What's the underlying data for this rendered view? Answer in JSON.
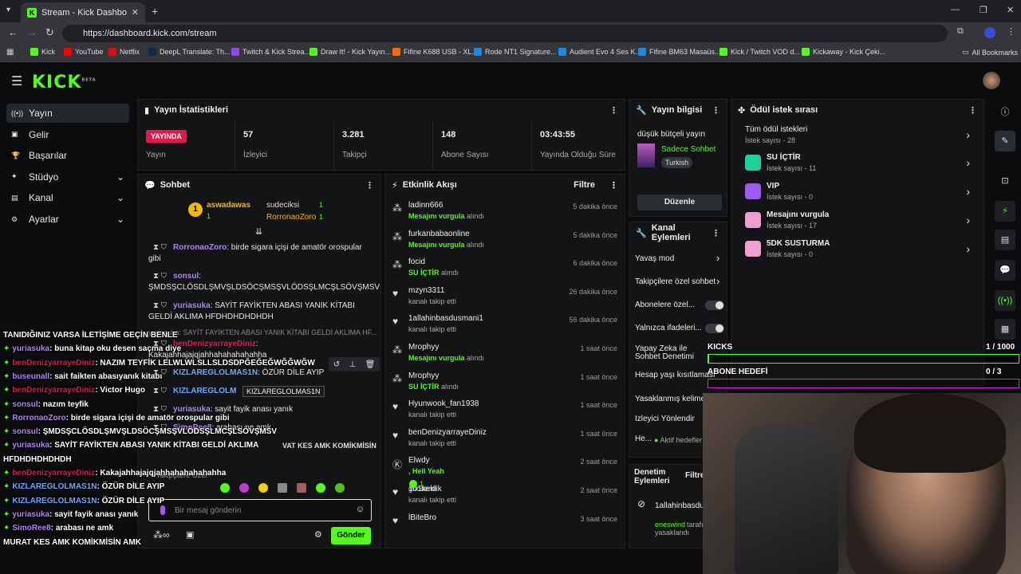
{
  "browser": {
    "tab_title": "Stream - Kick Dashboard",
    "url": "https://dashboard.kick.com/stream",
    "bookmarks": [
      "Kick",
      "YouTube",
      "Netflix",
      "DeepL Translate: Th...",
      "Twitch & Kick Strea...",
      "Draw It! - Kick Yayın...",
      "Fifine K688 USB - XL...",
      "Rode NT1 Signature...",
      "Audient Evo 4 Ses K...",
      "Fifine BM63 Masaüs...",
      "Kick / Twitch VOD d...",
      "Kickaway - Kick Çeki..."
    ],
    "all_bookmarks": "All Bookmarks"
  },
  "brand": {
    "logo": "KICK",
    "beta": "BETA",
    "accent": "#53fc18"
  },
  "sidebar": [
    {
      "label": "Yayın",
      "icon": "broadcast-icon"
    },
    {
      "label": "Gelir",
      "icon": "revenue-icon"
    },
    {
      "label": "Başarılar",
      "icon": "trophy-icon"
    },
    {
      "label": "Stüdyo",
      "icon": "studio-icon"
    },
    {
      "label": "Kanal",
      "icon": "channel-icon"
    },
    {
      "label": "Ayarlar",
      "icon": "gear-icon"
    }
  ],
  "stats": {
    "title": "Yayın İstatistikleri",
    "live": "YAYINDA",
    "items": [
      {
        "value": "",
        "label": "Yayın"
      },
      {
        "value": "57",
        "label": "İzleyici"
      },
      {
        "value": "3.281",
        "label": "Takipçi"
      },
      {
        "value": "148",
        "label": "Abone Sayısı"
      },
      {
        "value": "03:43:55",
        "label": "Yayında Olduğu Süre"
      }
    ]
  },
  "info": {
    "title": "Yayın bilgisi",
    "stream_title": "düşük bütçeli yayın",
    "category": "Sadece Sohbet",
    "language": "Turkish",
    "edit": "Düzenle"
  },
  "chat": {
    "title": "Sohbet",
    "top": [
      "aswadawas",
      "sudeciksi",
      "RorronaoZoro"
    ],
    "top_counts": [
      "1",
      "1",
      "1"
    ],
    "messages": [
      {
        "user": "RorronaoZoro",
        "color": "#b084f5",
        "text": ": birde sigara içişi de amatör orospular gibi"
      },
      {
        "user": "sonsul",
        "color": "#b084f5",
        "text": ": ŞMDSŞCLÖSDLŞMVŞLDSÖCŞMSŞVLÖDSŞLMCŞLSÖVŞMSV"
      },
      {
        "user": "yuriasuka",
        "color": "#b084f5",
        "text": ": SAYİT FAYİKTEN ABASI YANIK KİTABI GELDİ AKLIMA HFDHDHDHDHDH"
      },
      {
        "user": "benDenizyarrayeDiniz",
        "color": "#e0194b",
        "text": ": Kakajahhajajqjahhahahahahahha"
      },
      {
        "user": "KIZLAREGLOLMAS1N",
        "color": "#6aa8ff",
        "text": ": ÖZÜR DİLE AYIP"
      },
      {
        "user": "KIZLAREGLOLM",
        "color": "#6aa8ff",
        "text": ""
      },
      {
        "user": "yuriasuka",
        "color": "#b084f5",
        "text": ": sayit fayik anası yanık"
      },
      {
        "user": "SimoRee8",
        "color": "#b084f5",
        "text": ": arabası ne amk"
      }
    ],
    "reply": "yuriasuka: SAYİT FAYİKTEN ABASI YANIK KİTABI GELDİ AKLIMA HF...",
    "tooltip": "KIZLAREGLOLMAS1N",
    "followers_only": "Takipçilere Özel",
    "placeholder": "Bir mesaj gönderin",
    "send": "Gönder"
  },
  "overlay_chat": [
    {
      "user": "",
      "color": "#fff",
      "text": "TANIDIĞINIZ VARSA İLETİŞİME GEÇİN BENLE"
    },
    {
      "user": "yuriasuka",
      "color": "#b084f5",
      "text": ": buna kitap oku desen saçma diye"
    },
    {
      "user": "benDenizyarrayeDiniz",
      "color": "#e0194b",
      "text": ": NAZIM TEYFİK LELWLWLSLLSLDSDPĞEĞEĞWĞĞWĞW"
    },
    {
      "user": "buseunall",
      "color": "#b084f5",
      "text": ": sait faikten abasıyanık kitabı"
    },
    {
      "user": "benDenizyarrayeDiniz",
      "color": "#e0194b",
      "text": ": Victor Hugo"
    },
    {
      "user": "sonsul",
      "color": "#b084f5",
      "text": ": nazım teyfik"
    },
    {
      "user": "RorronaoZoro",
      "color": "#b084f5",
      "text": ": birde sigara içişi de amatör orospular gibi"
    },
    {
      "user": "sonsul",
      "color": "#b084f5",
      "text": ": ŞMDSŞCLÖSDLŞMVŞLDSÖCŞMSŞVLÖDSŞLMCŞLSÖVŞMSV"
    },
    {
      "user": "yuriasuka",
      "color": "#b084f5",
      "text": ": SAYİT FAYİKTEN ABASI YANIK KİTABI GELDİ AKLIMA"
    },
    {
      "user": "",
      "color": "#fff",
      "text": "HFDHDHDHDHDH"
    },
    {
      "user": "benDenizyarrayeDiniz",
      "color": "#e0194b",
      "text": ": Kakajahhajajqjahhahahahahahha"
    },
    {
      "user": "KIZLAREGLOLMAS1N",
      "color": "#6aa8ff",
      "text": ": ÖZÜR DİLE AYIP"
    },
    {
      "user": "KIZLAREGLOLMAS1N",
      "color": "#6aa8ff",
      "text": ": ÖZÜR DİLE AYIP"
    },
    {
      "user": "yuriasuka",
      "color": "#b084f5",
      "text": ": sayit fayik anası yanık"
    },
    {
      "user": "SimoRee8",
      "color": "#b084f5",
      "text": ": arabası ne amk"
    },
    {
      "user": "",
      "color": "#fff",
      "text": "MURAT KES AMK KOMİKMİSİN AMK"
    }
  ],
  "overlay_extra": "VAT KES AMK KOMİKMİSİN",
  "events": {
    "title": "Etkinlik Akışı",
    "filter": "Filtre",
    "items": [
      {
        "name": "ladinn666",
        "hl": "Mesajını vurgula",
        "rest": " alındı",
        "time": "5 dakika önce",
        "icon": "reward-icon"
      },
      {
        "name": "furkanbabaonline",
        "hl": "Mesajını vurgula",
        "rest": " alındı",
        "time": "5 dakika önce",
        "icon": "reward-icon"
      },
      {
        "name": "focid",
        "hl": "SU İÇTİR",
        "rest": " alındı",
        "time": "6 dakika önce",
        "icon": "reward-icon"
      },
      {
        "name": "mzyn3311",
        "hl": "",
        "rest": "kanalı takip etti",
        "time": "26 dakika önce",
        "icon": "heart-icon"
      },
      {
        "name": "1allahinbasdusmani1",
        "hl": "",
        "rest": "kanalı takip etti",
        "time": "56 dakika önce",
        "icon": "heart-icon"
      },
      {
        "name": "Mrophyy",
        "hl": "Mesajını vurgula",
        "rest": " alındı",
        "time": "1 saat önce",
        "icon": "reward-icon"
      },
      {
        "name": "Mrophyy",
        "hl": "SU İÇTİR",
        "rest": " alındı",
        "time": "1 saat önce",
        "icon": "reward-icon"
      },
      {
        "name": "Hyunwook_fan1938",
        "hl": "",
        "rest": "kanalı takip etti",
        "time": "1 saat önce",
        "icon": "heart-icon"
      },
      {
        "name": "benDenizyarrayeDiniz",
        "hl": "",
        "rest": "kanalı takip etti",
        "time": "1 saat önce",
        "icon": "heart-icon"
      },
      {
        "name": "Elwdy",
        "hl": ", Hell Yeah",
        "rest": "gönderdi",
        "time": "2 saat önce",
        "icon": "kick-icon"
      },
      {
        "name": "101keklik",
        "hl": "",
        "rest": "kanalı takip etti",
        "time": "2 saat önce",
        "icon": "heart-icon"
      },
      {
        "name": "lBiteBro",
        "hl": "",
        "rest": "",
        "time": "3 saat önce",
        "icon": "heart-icon"
      }
    ],
    "elwdy_count": "1"
  },
  "channel_actions": {
    "title": "Kanal Eylemleri",
    "items": [
      "Yavaş mod",
      "Takipçilere özel sohbet",
      "Abonelere özel...",
      "Yalnızca ifadeleri...",
      "Yapay Zeka ile",
      "Sohbet Denetimi",
      "Hesap yaşı kısıtlaması",
      "Yasaklanmış kelimeler",
      "İzleyici Yönlendir",
      "He..."
    ],
    "hosts": "Aktif hedefler"
  },
  "moderation": {
    "title1": "Denetim",
    "title2": "Eylemleri",
    "filter": "Filtre",
    "user": "1allahinbasdu",
    "actor": "eneswind",
    "action": "tarafı...",
    "result": "yasaklandı"
  },
  "rewards": {
    "title": "Ödül istek sırası",
    "items": [
      {
        "name": "Tüm ödül istekleri",
        "sub": "İstek sayısı - 28",
        "color": ""
      },
      {
        "name": "SU İÇTİR",
        "sub": "İstek sayısı - 11",
        "color": "#1fd19a"
      },
      {
        "name": "VIP",
        "sub": "İstek sayısı - 0",
        "color": "#9b5cf0"
      },
      {
        "name": "Mesajını vurgula",
        "sub": "İstek sayısı - 17",
        "color": "#f0a0d0"
      },
      {
        "name": "5DK SUSTURMA",
        "sub": "İstek sayısı - 0",
        "color": "#f0a0d0"
      }
    ]
  },
  "goals": [
    {
      "label": "KICKS",
      "value": "1 / 1000",
      "progress": 0.001,
      "color": "#53fc18"
    },
    {
      "label": "ABONE HEDEFİ",
      "value": "0 / 3",
      "progress": 0,
      "color": "#d628d6"
    }
  ]
}
